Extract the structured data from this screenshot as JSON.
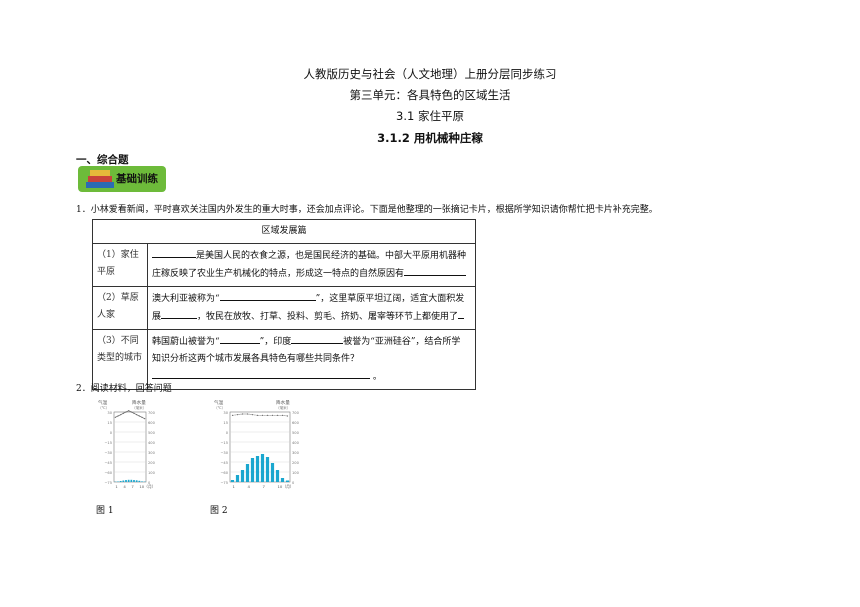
{
  "header": {
    "line1": "人教版历史与社会（人文地理）上册分层同步练习",
    "line2": "第三单元：各具特色的区域生活",
    "line3": "3.1 家住平原",
    "line4": "3.1.2 用机械种庄稼"
  },
  "section": {
    "title": "一、综合题",
    "badge": "基础训练"
  },
  "q1": {
    "text": "1．小林爱看新闻，平时喜欢关注国内外发生的重大时事，还会加点评论。下面是他整理的一张摘记卡片，根据所学知识请你帮忙把卡片补充完整。",
    "card_title": "区域发展篇",
    "rows": [
      {
        "label": "（1）家住平原",
        "a": "是美国人民的衣食之源，也是国民经济的基础。中部大平原用机器种",
        "b": "庄稼反映了农业生产机械化的特点，形成这一特点的自然原因有"
      },
      {
        "label": "（2）草原人家",
        "a": "澳大利亚被称为“",
        "a2": "”，这里草原平坦辽阔，适宜大面积发",
        "b": "展",
        "b2": "，牧民在放牧、打草、投料、剪毛、挤奶、屠宰等环节上都使用了"
      },
      {
        "label": "（3）不同类型的城市",
        "a": "韩国蔚山被誉为“",
        "a2": "”，印度",
        "a3": "被誉为“亚洲硅谷”，结合所学",
        "b": "知识分析这两个城市发展各具特色有哪些共同条件？",
        "c": "。"
      }
    ]
  },
  "q2": {
    "text": "2．阅读材料，回答问题",
    "fig1": "图 1",
    "fig2": "图 2"
  },
  "charts": {
    "temp_label": "气温",
    "temp_unit": "（℃）",
    "precip_label": "降水量",
    "precip_unit": "（毫米）",
    "y_left": [
      "30",
      "15",
      "0",
      "−15",
      "−30",
      "−45",
      "−60",
      "−75"
    ],
    "y_right": [
      "700",
      "600",
      "500",
      "400",
      "300",
      "200",
      "100",
      "0"
    ],
    "x_ticks": [
      "1",
      "4",
      "7",
      "10（月）"
    ]
  },
  "chart_data": [
    {
      "type": "bar",
      "categories": [
        "1",
        "2",
        "3",
        "4",
        "5",
        "6",
        "7",
        "8",
        "9",
        "10",
        "11",
        "12"
      ],
      "series": [
        {
          "values": [
            22,
            24,
            26,
            28,
            30,
            32,
            30,
            28,
            26,
            24,
            22,
            20
          ]
        },
        {
          "values": [
            3,
            5,
            10,
            15,
            20,
            22,
            22,
            20,
            17,
            12,
            6,
            4
          ]
        }
      ],
      "xlabel": "（月）",
      "ylim_left": [
        -75,
        30
      ],
      "ylim_right": [
        0,
        700
      ]
    },
    {
      "type": "bar",
      "categories": [
        "1",
        "2",
        "3",
        "4",
        "5",
        "6",
        "7",
        "8",
        "9",
        "10",
        "11",
        "12"
      ],
      "series": [
        {
          "values": [
            20,
            70,
            120,
            180,
            240,
            260,
            280,
            250,
            190,
            120,
            40,
            15
          ]
        },
        {
          "values": [
            25,
            26,
            27,
            27,
            26,
            25,
            25,
            25,
            25,
            25,
            25,
            24
          ]
        }
      ],
      "xlabel": "（月）",
      "ylim_left": [
        -75,
        30
      ],
      "ylim_right": [
        0,
        700
      ]
    }
  ]
}
